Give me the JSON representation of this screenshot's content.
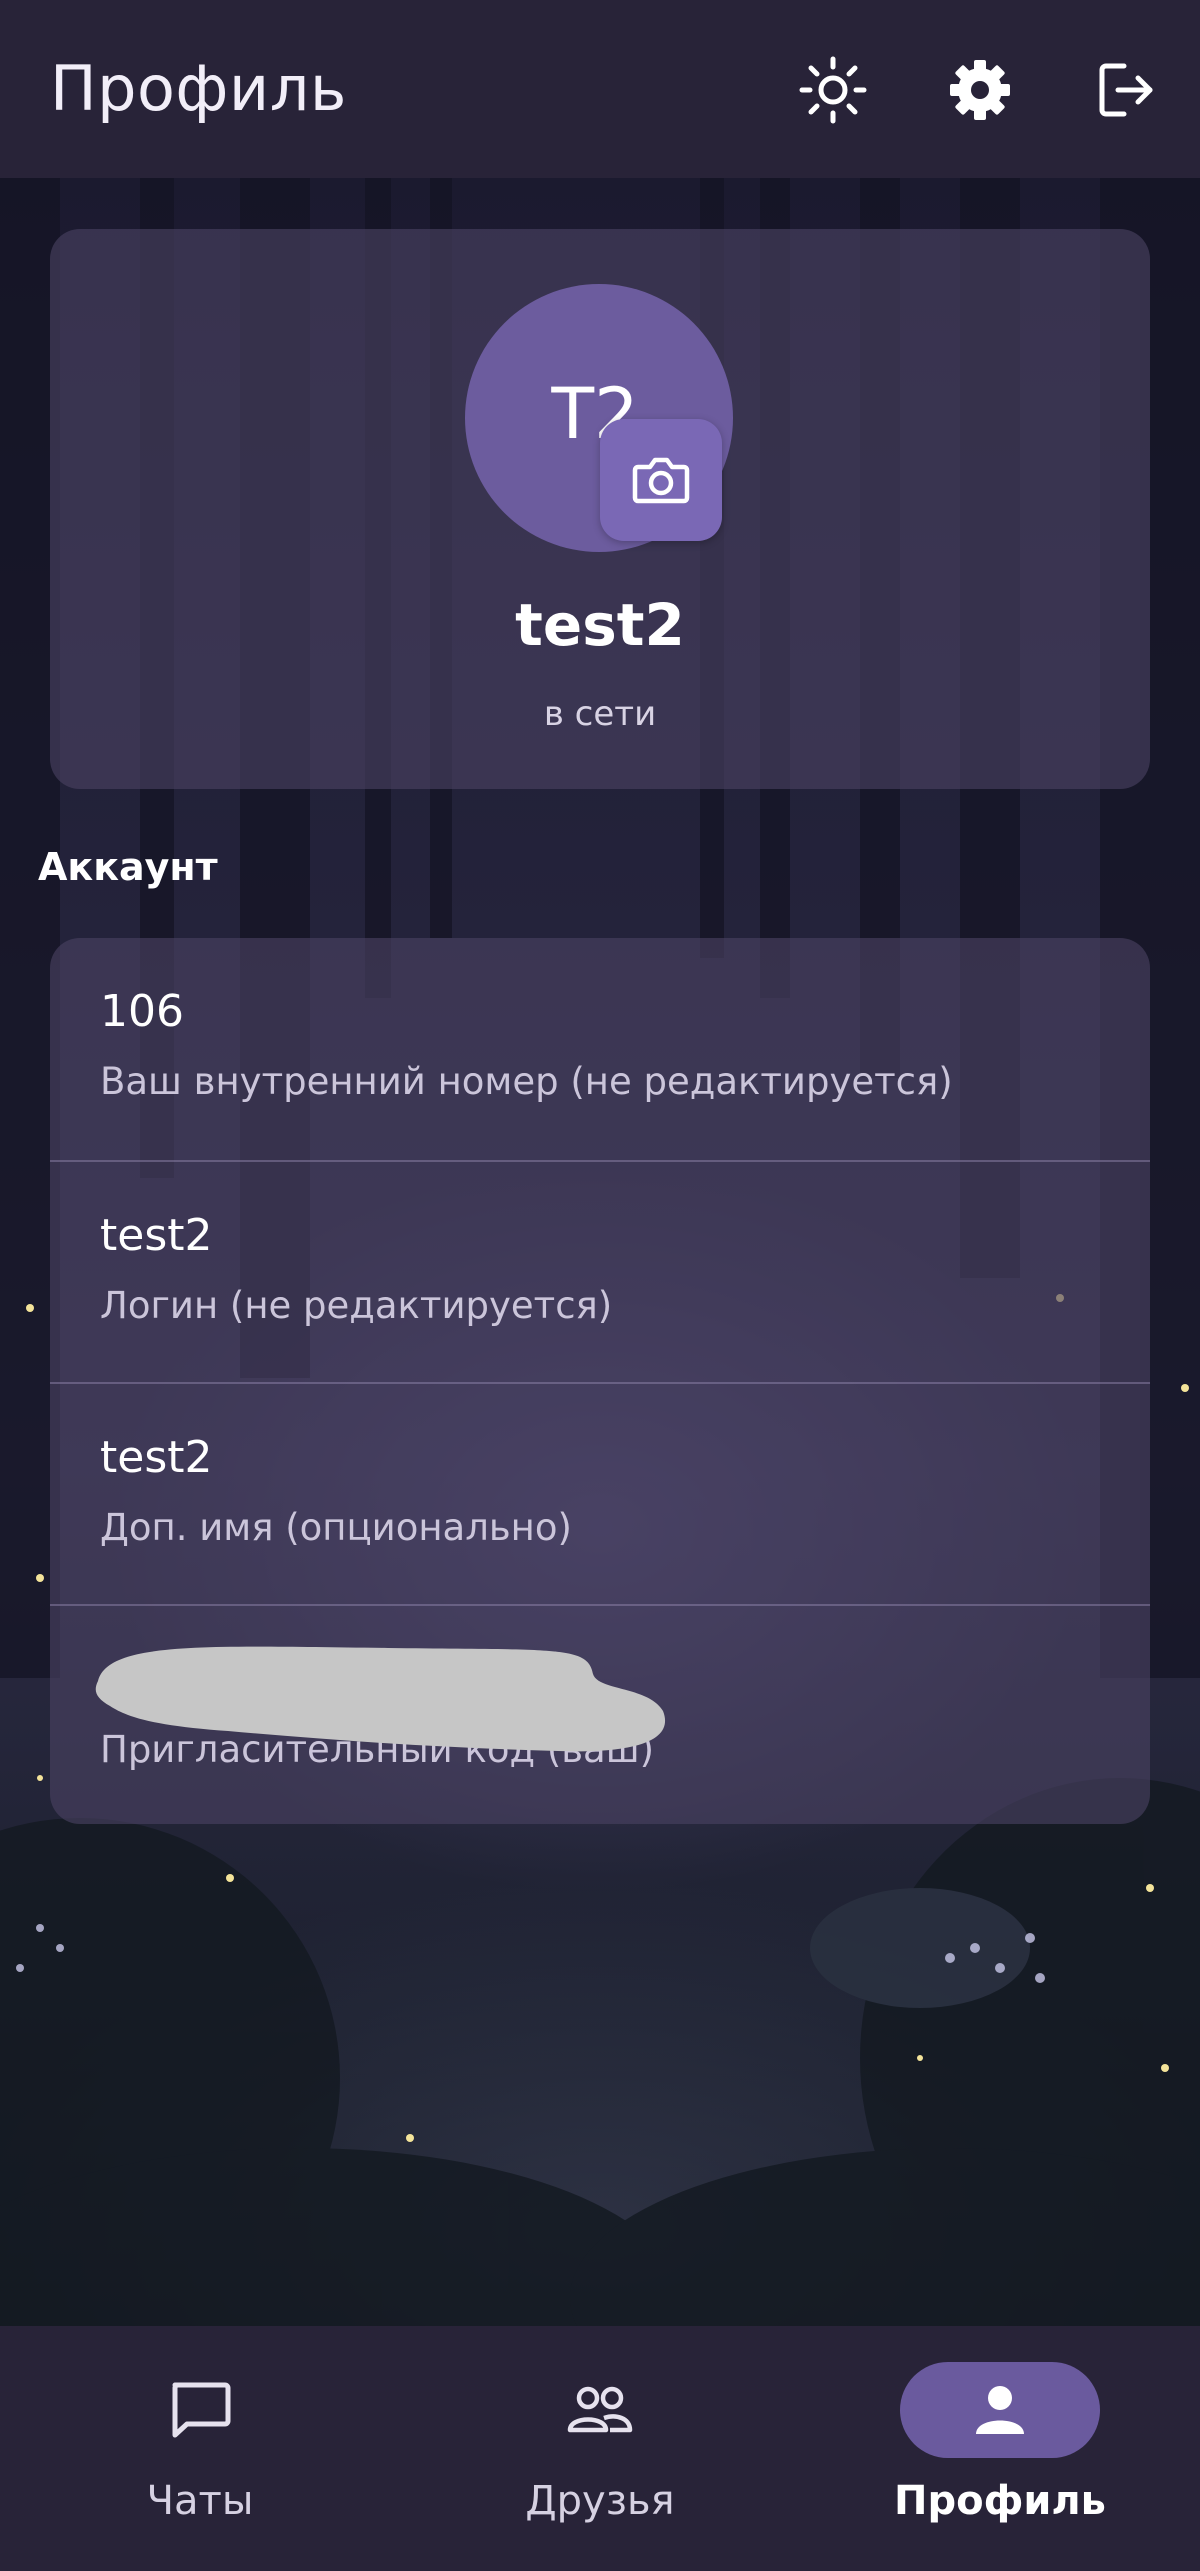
{
  "header": {
    "title": "Профиль",
    "icons": [
      "sun-icon",
      "gear-icon",
      "logout-icon"
    ]
  },
  "profile": {
    "initials": "T2",
    "username": "test2",
    "status": "в сети"
  },
  "account": {
    "section_title": "Аккаунт",
    "rows": [
      {
        "value": "106",
        "caption": "Ваш внутренний номер (не редактируется)"
      },
      {
        "value": "test2",
        "caption": "Логин (не редактируется)"
      },
      {
        "value": "test2",
        "caption": "Доп. имя (опционально)"
      },
      {
        "value": "",
        "caption": "Пригласительный код (ваш)"
      }
    ]
  },
  "nav": {
    "items": [
      {
        "label": "Чаты",
        "icon": "chat-bubble-icon",
        "active": false
      },
      {
        "label": "Друзья",
        "icon": "people-icon",
        "active": false
      },
      {
        "label": "Профиль",
        "icon": "person-icon",
        "active": true
      }
    ]
  },
  "colors": {
    "accent": "#6a5a9e",
    "header_bg": "#282338",
    "card_bg": "#4a4262"
  }
}
